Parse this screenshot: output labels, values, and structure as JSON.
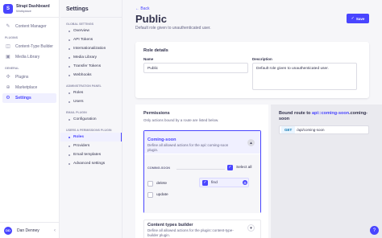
{
  "brand": {
    "title": "Strapi Dashboard",
    "subtitle": "Workplace",
    "logo_letter": "S"
  },
  "mainnav": {
    "content_manager": "Content Manager",
    "plugins_section": "Plugins",
    "content_type_builder": "Content-Type Builder",
    "media_library": "Media Library",
    "general_section": "General",
    "plugins": "Plugins",
    "marketplace": "Marketplace",
    "settings": "Settings"
  },
  "user": {
    "initials": "DD",
    "name": "Dan Denney"
  },
  "subnav": {
    "title": "Settings",
    "global_section": "Global settings",
    "global_items": [
      "Overview",
      "API Tokens",
      "Internationalization",
      "Media Library",
      "Transfer Tokens",
      "Webhooks"
    ],
    "admin_section": "Administration panel",
    "admin_items": [
      "Roles",
      "Users"
    ],
    "email_section": "Email plugin",
    "email_items": [
      "Configuration"
    ],
    "up_section": "Users & permissions plugin",
    "up_items": [
      "Roles",
      "Providers",
      "Email templates",
      "Advanced settings"
    ]
  },
  "header": {
    "back": "Back",
    "title": "Public",
    "subtitle": "Default role given to unauthenticated user.",
    "save": "Save"
  },
  "role_details": {
    "title": "Role details",
    "name_label": "Name",
    "name_value": "Public",
    "description_label": "Description",
    "description_value": "Default role given to unauthenticated user."
  },
  "permissions": {
    "title": "Permissions",
    "subtitle": "Only actions bound by a route are listed below.",
    "coming_soon": {
      "title": "Coming-soon",
      "description": "Define all allowed actions for the api::coming-soon plugin.",
      "group_label": "COMING-SOON",
      "select_all": "Select all",
      "select_all_checked": true,
      "actions": [
        {
          "label": "delete",
          "checked": false
        },
        {
          "label": "find",
          "checked": true
        },
        {
          "label": "update",
          "checked": false
        }
      ]
    },
    "content_types_builder": {
      "title": "Content types builder",
      "description": "Define all allowed actions for the plugin::content-type-builder plugin."
    }
  },
  "route": {
    "title_prefix": "Bound route to",
    "title_highlight": "api::coming-soon",
    "title_rest": ".coming-soon",
    "method": "GET",
    "path": "/api/coming-soon"
  },
  "colors": {
    "primary": "#4945ff",
    "active_bg": "#f0f0ff"
  }
}
